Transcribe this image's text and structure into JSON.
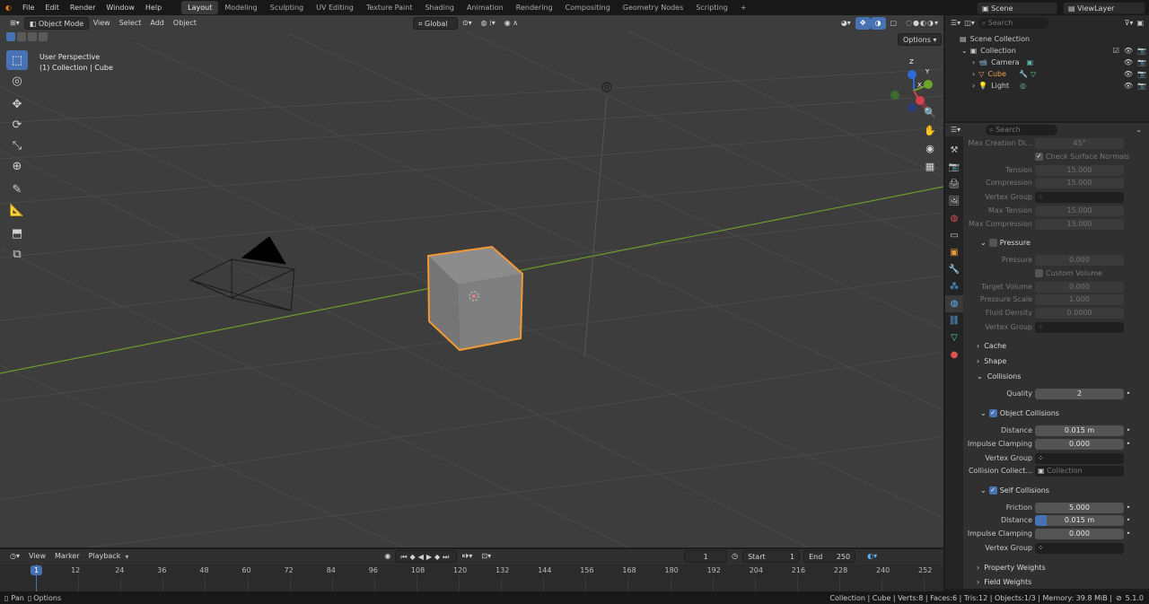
{
  "topbar": {
    "menus": [
      "File",
      "Edit",
      "Render",
      "Window",
      "Help"
    ],
    "workspaces": [
      "Layout",
      "Modeling",
      "Sculpting",
      "UV Editing",
      "Texture Paint",
      "Shading",
      "Animation",
      "Rendering",
      "Compositing",
      "Geometry Nodes",
      "Scripting"
    ],
    "add_tab": "+",
    "scene": "Scene",
    "view_layer": "ViewLayer"
  },
  "viewport": {
    "mode": "Object Mode",
    "menus": [
      "View",
      "Select",
      "Add",
      "Object"
    ],
    "orientation": "Global",
    "options": "Options",
    "perspective": "User Perspective",
    "collection_info": "(1) Collection | Cube",
    "gizmo": {
      "z": "Z",
      "y": "Y",
      "x": "X"
    }
  },
  "outliner": {
    "search_placeholder": "Search",
    "scene_collection": "Scene Collection",
    "collection": "Collection",
    "items": [
      "Camera",
      "Cube",
      "Light"
    ]
  },
  "properties": {
    "search_placeholder": "Search",
    "rows": [
      {
        "label": "Max Creation Di...",
        "value": "45°",
        "dim": true
      },
      {
        "label": "Tension",
        "value": "15.000",
        "dim": true
      },
      {
        "label": "Compression",
        "value": "15.000",
        "dim": true
      },
      {
        "label": "Vertex Group",
        "value": "",
        "dim": true
      },
      {
        "label": "Max Tension",
        "value": "15.000",
        "dim": true
      },
      {
        "label": "Max Compression",
        "value": "15.000",
        "dim": true
      },
      {
        "label": "Pressure",
        "value": "0.000",
        "dim": true
      },
      {
        "label": "Target Volume",
        "value": "0.000",
        "dim": true
      },
      {
        "label": "Pressure Scale",
        "value": "1.000",
        "dim": true
      },
      {
        "label": "Fluid Density",
        "value": "0.0000",
        "dim": true
      },
      {
        "label": "Vertex Group",
        "value": "",
        "dim": true
      },
      {
        "label": "Quality",
        "value": "2"
      },
      {
        "label": "Distance",
        "value": "0.015 m"
      },
      {
        "label": "Impulse Clamping",
        "value": "0.000"
      },
      {
        "label": "Vertex Group",
        "value": ""
      },
      {
        "label": "Collision Collect...",
        "value": "Collection"
      },
      {
        "label": "Friction",
        "value": "5.000"
      },
      {
        "label": "Distance",
        "value": "0.015 m"
      },
      {
        "label": "Impulse Clamping",
        "value": "0.000"
      },
      {
        "label": "Vertex Group",
        "value": ""
      }
    ],
    "check_surface_normals": "Check Surface Normals",
    "custom_volume": "Custom Volume",
    "sections": {
      "pressure": "Pressure",
      "cache": "Cache",
      "shape": "Shape",
      "collisions": "Collisions",
      "object_collisions": "Object Collisions",
      "self_collisions": "Self Collisions",
      "property_weights": "Property Weights",
      "field_weights": "Field Weights"
    }
  },
  "timeline": {
    "menus": [
      "View",
      "Marker",
      "Playback"
    ],
    "current_frame": "1",
    "start_label": "Start",
    "start": "1",
    "end_label": "End",
    "end": "250",
    "ticks": [
      "1",
      "12",
      "24",
      "36",
      "48",
      "60",
      "72",
      "84",
      "96",
      "108",
      "120",
      "132",
      "144",
      "156",
      "168",
      "180",
      "192",
      "204",
      "216",
      "228",
      "240",
      "252"
    ]
  },
  "statusbar": {
    "left1": "Pan",
    "left2": "Options",
    "right": "Collection | Cube | Verts:8 | Faces:6 | Tris:12 | Objects:1/3 | Memory: 39.8 MiB |",
    "version": "5.1.0"
  },
  "colors": {
    "accent": "#4772b3",
    "selection": "#f19a34",
    "x_axis": "#6a9c2a"
  }
}
